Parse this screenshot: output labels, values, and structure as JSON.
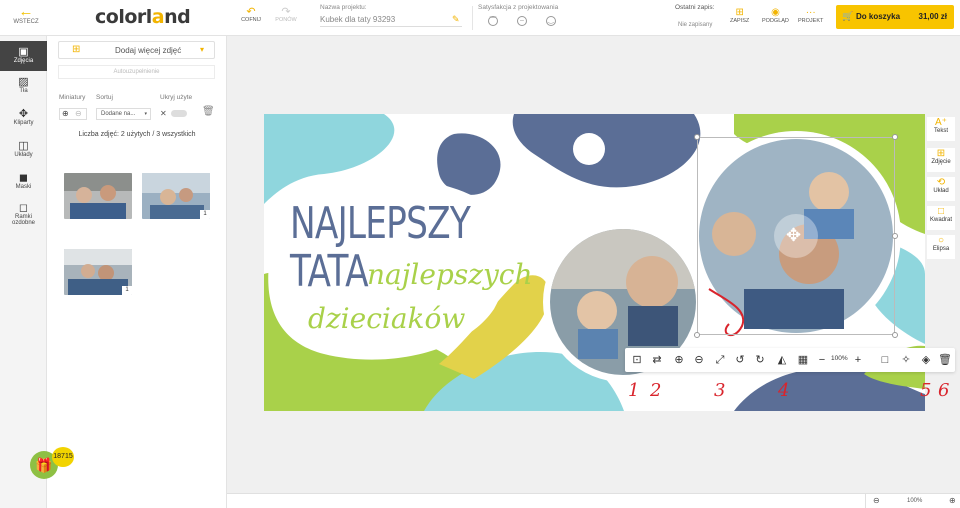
{
  "header": {
    "back_label": "WSTECZ",
    "logo_main": "colorl",
    "logo_o": "a",
    "logo_end": "nd",
    "undo_label": "COFNIJ",
    "redo_label": "PONÓW",
    "project_name_label": "Nazwa projektu:",
    "project_name_value": "Kubek dla taty 93293",
    "satisfaction_label": "Satysfakcja z projektowania",
    "last_save_label": "Ostatni zapis:",
    "not_saved": "Nie zapisany",
    "save_label": "ZAPISZ",
    "preview_label": "PODGLĄD",
    "project_label": "PROJEKT",
    "cart_label": "Do koszyka",
    "cart_price": "31,00 zł"
  },
  "sidebar_nav": [
    {
      "label": "Zdjęcia",
      "icon": "image-icon",
      "active": true
    },
    {
      "label": "Tła",
      "icon": "background-icon"
    },
    {
      "label": "Kliparty",
      "icon": "clipart-icon"
    },
    {
      "label": "Układy",
      "icon": "layout-icon"
    },
    {
      "label": "Maski",
      "icon": "mask-icon"
    },
    {
      "label": "Ramki",
      "label2": "ozdobne",
      "icon": "frame-icon"
    }
  ],
  "gift_badge": "18715",
  "panel": {
    "add_more": "Dodaj więcej zdjęć",
    "autofill": "Autouzupełnienie",
    "thumbnails_label": "Miniatury",
    "sort_label": "Sortuj",
    "hide_used_label": "Ukryj użyte",
    "sort_value": "Dodane na...",
    "photo_count": "Liczba zdjęć: 2 użytych / 3 wszystkich",
    "thumbs": [
      {
        "badge": ""
      },
      {
        "badge": "1"
      },
      {
        "badge": "1"
      }
    ]
  },
  "design": {
    "line1": "NAJLEPSZY",
    "line2a": "TATA",
    "line2b": "najlepszych",
    "line3": "dzieciaków"
  },
  "right_tools": [
    {
      "label": "Tekst",
      "icon": "text-add-icon"
    },
    {
      "label": "Zdjęcie",
      "icon": "image-add-icon"
    },
    {
      "label": "Układ",
      "icon": "layout-cycle-icon"
    },
    {
      "label": "Kwadrat",
      "icon": "square-icon"
    },
    {
      "label": "Elipsa",
      "icon": "ellipse-icon"
    }
  ],
  "image_toolbar": {
    "zoom": "100%",
    "annotations": [
      "1",
      "2",
      "3",
      "4",
      "5",
      "6"
    ]
  },
  "bottom": {
    "zoom": "100%"
  },
  "colors": {
    "accent": "#f8c400",
    "navy": "#5b6e96",
    "lime": "#a9d14a",
    "aqua": "#8fd6dd",
    "mustard": "#e2d24a",
    "annotation": "#d9242c"
  }
}
